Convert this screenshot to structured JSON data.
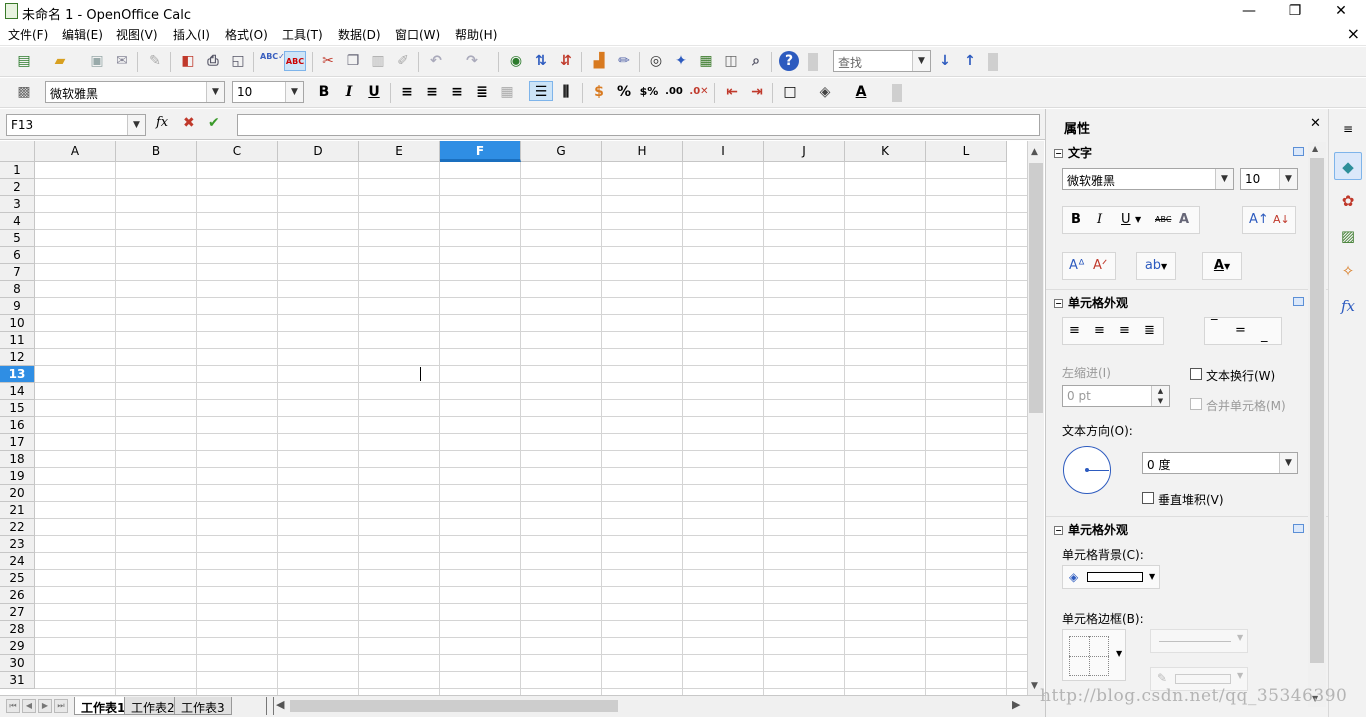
{
  "window": {
    "title": "未命名 1 - OpenOffice Calc",
    "minimize": "—",
    "maximize": "❐",
    "close": "✕"
  },
  "menu": [
    "文件(F)",
    "编辑(E)",
    "视图(V)",
    "插入(I)",
    "格式(O)",
    "工具(T)",
    "数据(D)",
    "窗口(W)",
    "帮助(H)"
  ],
  "toolbar": {
    "find_placeholder": "查找",
    "font_name": "微软雅黑",
    "font_size": "10",
    "bold": "B",
    "italic": "I",
    "underline": "U"
  },
  "formula_bar": {
    "name_box": "F13",
    "function_wizard": "fx",
    "cancel": "✖",
    "accept": "✔",
    "input": ""
  },
  "grid": {
    "columns": [
      "A",
      "B",
      "C",
      "D",
      "E",
      "F",
      "G",
      "H",
      "I",
      "J",
      "K",
      "L"
    ],
    "selected_column": "F",
    "rows": [
      "1",
      "2",
      "3",
      "4",
      "5",
      "6",
      "7",
      "8",
      "9",
      "10",
      "11",
      "12",
      "13",
      "14",
      "15",
      "16",
      "17",
      "18",
      "19",
      "20",
      "21",
      "22",
      "23",
      "24",
      "25",
      "26",
      "27",
      "28",
      "29",
      "30",
      "31"
    ],
    "selected_row": "13",
    "active_cell": "F13"
  },
  "sheets": {
    "tabs": [
      "工作表1",
      "工作表2",
      "工作表3"
    ],
    "active": "工作表1"
  },
  "sidebar": {
    "title": "属性",
    "close": "✕",
    "text_section": {
      "title": "文字",
      "font_name": "微软雅黑",
      "font_size": "10",
      "bold": "B",
      "italic": "I",
      "underline": "U",
      "strikethrough": "ABC",
      "shadow": "A"
    },
    "alignment_section": {
      "title": "单元格外观",
      "left_indent_label": "左缩进(I)",
      "left_indent_value": "0 pt",
      "wrap_text": "文本换行(W)",
      "merge_cells": "合并单元格(M)",
      "text_direction_label": "文本方向(O):",
      "text_direction_value": "0 度",
      "vertical_stack": "垂直堆积(V)"
    },
    "appearance_section": {
      "title": "单元格外观",
      "background_label": "单元格背景(C):",
      "border_label": "单元格边框(B):"
    }
  },
  "watermark": "http://blog.csdn.net/qq_35346390"
}
